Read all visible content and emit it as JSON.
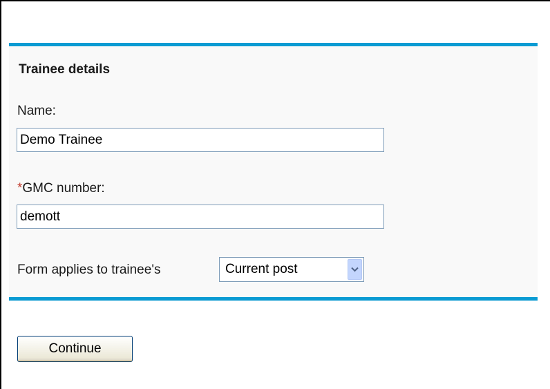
{
  "form": {
    "section_title": "Trainee details",
    "name": {
      "label": "Name:",
      "value": "Demo Trainee"
    },
    "gmc": {
      "required_marker": "*",
      "label": "GMC number:",
      "value": "demott"
    },
    "applies_to": {
      "label": "Form applies to trainee's",
      "selected": "Current post"
    },
    "continue_label": "Continue"
  },
  "colors": {
    "accent_rule": "#0a9bd3",
    "required": "#c0392b",
    "input_border": "#7f9db9"
  },
  "icons": {
    "dropdown": "chevron-down-icon"
  }
}
